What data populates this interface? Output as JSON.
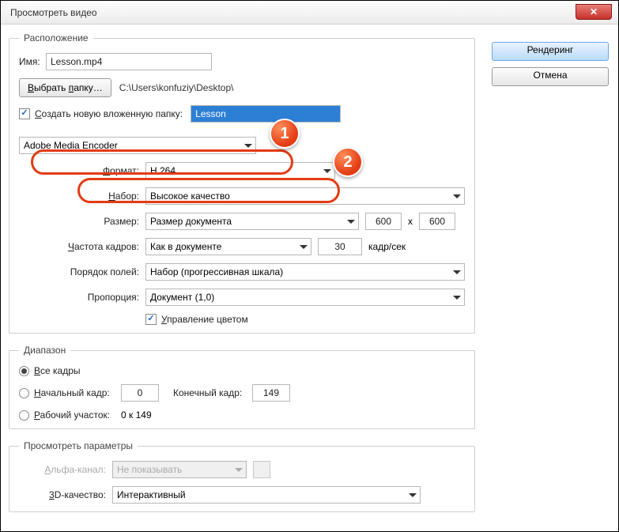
{
  "window": {
    "title": "Просмотреть видео"
  },
  "buttons": {
    "render": "Рендеринг",
    "cancel": "Отмена",
    "browse": "Выбрать папку…"
  },
  "location": {
    "legend": "Расположение",
    "name_label": "Имя:",
    "name_value": "Lesson.mp4",
    "path": "C:\\Users\\konfuziy\\Desktop\\",
    "subfolder_label": "Создать новую вложенную папку:",
    "subfolder_value": "Lesson",
    "encoder": "Adobe Media Encoder",
    "format_label": "Формат:",
    "format_value": "H.264",
    "preset_label": "Набор:",
    "preset_value": "Высокое качество",
    "size_label": "Размер:",
    "size_value": "Размер документа",
    "width": "600",
    "x": "x",
    "height": "600",
    "fps_label": "Частота кадров:",
    "fps_mode": "Как в документе",
    "fps_value": "30",
    "fps_unit": "кадр/сек",
    "field_label": "Порядок полей:",
    "field_value": "Набор (прогрессивная шкала)",
    "ratio_label": "Пропорция:",
    "ratio_value": "Документ (1,0)",
    "color_mgmt": "Управление цветом"
  },
  "range": {
    "legend": "Диапазон",
    "all": "Все кадры",
    "start_label": "Начальный кадр:",
    "start_value": "0",
    "end_label": "Конечный кадр:",
    "end_value": "149",
    "work_label": "Рабочий участок:",
    "work_value": "0 к 149"
  },
  "preview": {
    "legend": "Просмотреть параметры",
    "alpha_label": "Альфа-канал:",
    "alpha_value": "Не показывать",
    "quality_label": "3D-качество:",
    "quality_value": "Интерактивный"
  },
  "callouts": {
    "one": "1",
    "two": "2"
  }
}
